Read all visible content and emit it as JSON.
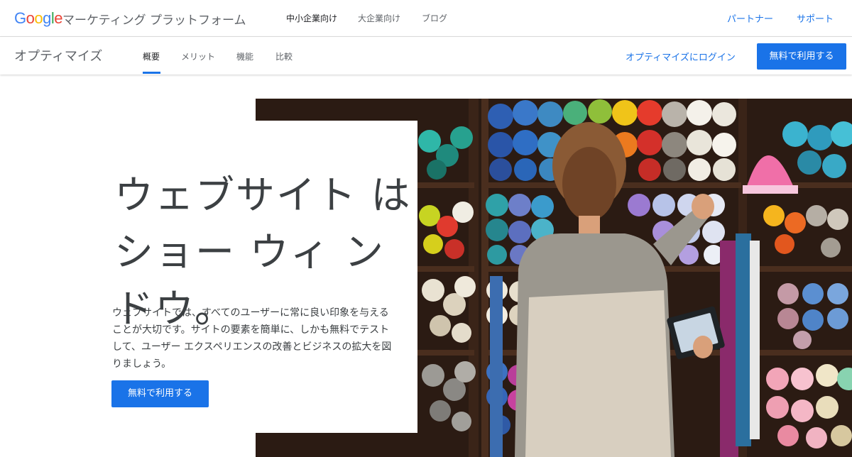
{
  "header": {
    "brand_google": "Google",
    "brand_sub": "マーケティング プラットフォーム",
    "nav": [
      {
        "label": "中小企業向け"
      },
      {
        "label": "大企業向け"
      },
      {
        "label": "ブログ"
      }
    ],
    "links": {
      "partner": "パートナー",
      "support": "サポート"
    }
  },
  "subheader": {
    "product": "オプティマイズ",
    "tabs": [
      {
        "label": "概要"
      },
      {
        "label": "メリット"
      },
      {
        "label": "機能"
      },
      {
        "label": "比較"
      }
    ],
    "login": "オプティマイズにログイン",
    "cta": "無料で利用する"
  },
  "hero": {
    "headline": "ウェブサイト はショー ウィ ンドウ。",
    "description": "ウェブサイトでは、すべてのユーザーに常に良い印象を与えることが大切です。サイトの要素を簡単に、しかも無料でテストして、ユーザー エクスペリエンスの改善とビジネスの拡大を図りましょう。",
    "cta": "無料で利用する"
  },
  "colors": {
    "accent": "#1a73e8",
    "google_blue": "#4285f4",
    "google_red": "#ea4335",
    "google_yellow": "#fbbc05",
    "google_green": "#34a853"
  }
}
